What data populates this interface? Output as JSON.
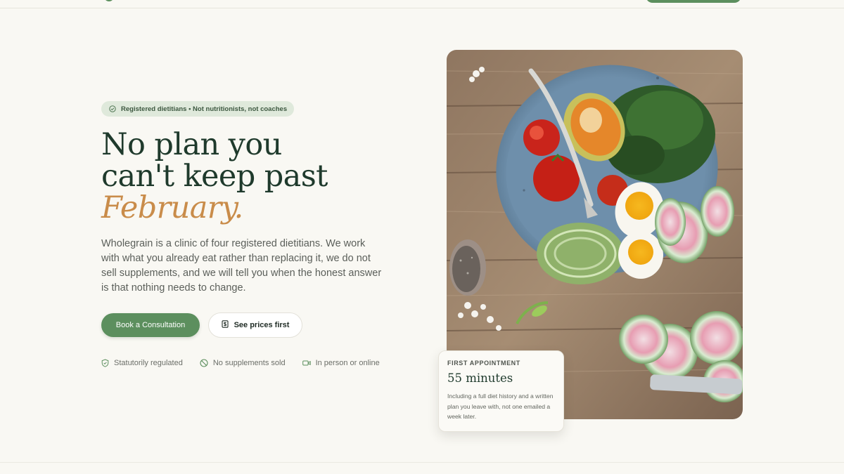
{
  "hero": {
    "badge": "Registered dietitians • Not nutritionists, not coaches",
    "headline_line1": "No plan you",
    "headline_line2": "can't keep past",
    "headline_accent": "February.",
    "lead": "Wholegrain is a clinic of four registered dietitians. We work with what you already eat rather than replacing it, we do not sell supplements, and we will tell you when the honest answer is that nothing needs to change.",
    "primary_cta": "Book a Consultation",
    "secondary_cta": "See prices first",
    "trust": [
      {
        "label": "Statutorily regulated",
        "icon": "shield-check-icon"
      },
      {
        "label": "No supplements sold",
        "icon": "ban-icon"
      },
      {
        "label": "In person or online",
        "icon": "video-icon"
      }
    ]
  },
  "appointment_card": {
    "eyebrow": "FIRST APPOINTMENT",
    "duration": "55 minutes",
    "description": "Including a full diet history and a written plan you leave with, not one emailed a week later."
  },
  "colors": {
    "accent_green": "#5c8f5e",
    "headline_green": "#1f3a2c",
    "accent_orange": "#c98c4a",
    "background": "#f9f8f3"
  }
}
